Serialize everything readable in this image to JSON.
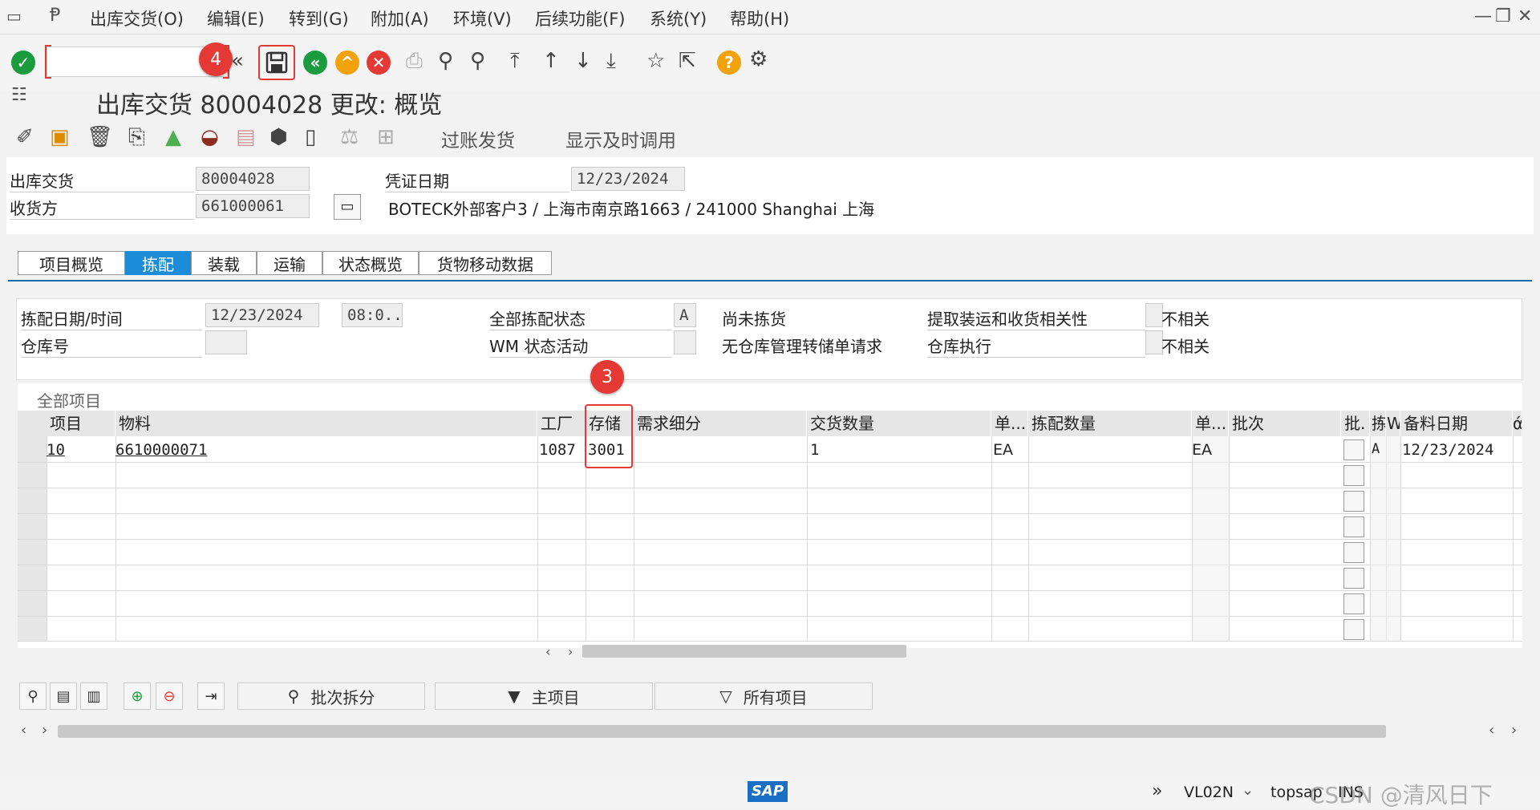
{
  "menu": {
    "items": [
      "出库交货(O)",
      "编辑(E)",
      "转到(G)",
      "附加(A)",
      "环境(V)",
      "后续功能(F)",
      "系统(Y)",
      "帮助(H)"
    ]
  },
  "annotations": {
    "step3": "3",
    "step4": "4"
  },
  "title": "出库交货 80004028 更改: 概览",
  "app_toolbar": {
    "post_goods_issue": "过账发货",
    "display_timely": "显示及时调用"
  },
  "header": {
    "delivery_label": "出库交货",
    "delivery_value": "80004028",
    "ship_to_label": "收货方",
    "ship_to_value": "661000061",
    "doc_date_label": "凭证日期",
    "doc_date_value": "12/23/2024",
    "address": "BOTECK外部客户3 / 上海市南京路1663 / 241000 Shanghai 上海"
  },
  "tabs": [
    "项目概览",
    "拣配",
    "装载",
    "运输",
    "状态概览",
    "货物移动数据"
  ],
  "picking": {
    "date_time_label": "拣配日期/时间",
    "date_value": "12/23/2024",
    "time_value": "08:0...",
    "warehouse_label": "仓库号",
    "warehouse_value": "",
    "overall_status_label": "全部拣配状态",
    "overall_status_value": "A",
    "wm_label": "WM 状态活动",
    "wm_value": "",
    "not_picked": "尚未拣货",
    "no_wm": "无仓库管理转储单请求",
    "relevance_label": "提取装运和收货相关性",
    "relevance_value": "不相关",
    "wh_exec_label": "仓库执行",
    "wh_exec_value": "不相关"
  },
  "grid": {
    "title": "全部项目",
    "columns": [
      "项目",
      "物料",
      "工厂",
      "存储",
      "需求细分",
      "交货数量",
      "单...",
      "拣配数量",
      "单...",
      "批次",
      "批.",
      "拣",
      "W",
      "备料日期",
      "ά"
    ],
    "rows": [
      {
        "item": "10",
        "material": "6610000071",
        "plant": "1087",
        "sloc": "3001",
        "req": "",
        "qty": "1",
        "unit": "EA",
        "pick_qty": "",
        "pick_unit": "EA",
        "batch": "",
        "status": "A",
        "date": "12/23/2024"
      }
    ]
  },
  "buttons": {
    "batch_split": "批次拆分",
    "main_items": "主项目",
    "all_items": "所有项目"
  },
  "status_bar": {
    "tcode": "VL02N",
    "user": "topsap",
    "mode": "INS",
    "sap_logo": "SAP",
    "watermark": "CSDN @清风日下"
  },
  "colors": {
    "accent": "#1a8cd8",
    "green": "#1a9c3e",
    "orange": "#f2a20c",
    "red": "#e53935"
  }
}
